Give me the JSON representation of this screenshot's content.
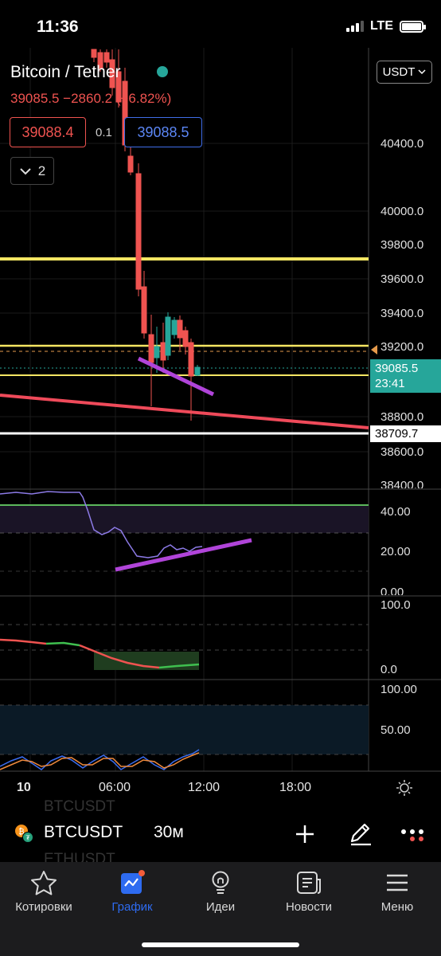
{
  "status": {
    "time": "11:36",
    "network": "LTE"
  },
  "header": {
    "symbol_title": "Bitcoin / Tether",
    "price_change": "39085.5  −2860.2 (−6.82%)",
    "bid": "39088.4",
    "spread": "0.1",
    "ask": "39088.5",
    "collapse_count": "2",
    "currency": "USDT"
  },
  "price_axis": {
    "labels": [
      "40400.0",
      "40000.0",
      "39800.0",
      "39600.0",
      "39400.0",
      "39200.0",
      "38800.0",
      "38600.0",
      "38400.0"
    ],
    "last_price": "39085.5",
    "countdown": "23:41",
    "line_price": "38709.7"
  },
  "rsi_axis": [
    "40.00",
    "20.00",
    "0.00"
  ],
  "osc1_axis": [
    "100.0",
    "0.0"
  ],
  "osc2_axis": [
    "100.00",
    "50.00"
  ],
  "time_axis": [
    "10",
    "06:00",
    "12:00",
    "18:00"
  ],
  "symbol_bar": {
    "ghost_prev": "BTCUSDT",
    "symbol": "BTCUSDT",
    "interval": "30м",
    "ghost_next": "ETHUSDT"
  },
  "tabs": [
    {
      "label": "Котировки",
      "icon": "star-icon"
    },
    {
      "label": "График",
      "icon": "chart-icon"
    },
    {
      "label": "Идеи",
      "icon": "lightbulb-icon"
    },
    {
      "label": "Новости",
      "icon": "news-icon"
    },
    {
      "label": "Меню",
      "icon": "menu-icon"
    }
  ],
  "colors": {
    "up": "#26a69a",
    "down": "#ef5350",
    "accent": "#2e6bf0",
    "horizontal_line": "#f5e663",
    "trend_line": "#ef4a5a",
    "annotation": "#b044d9"
  }
}
